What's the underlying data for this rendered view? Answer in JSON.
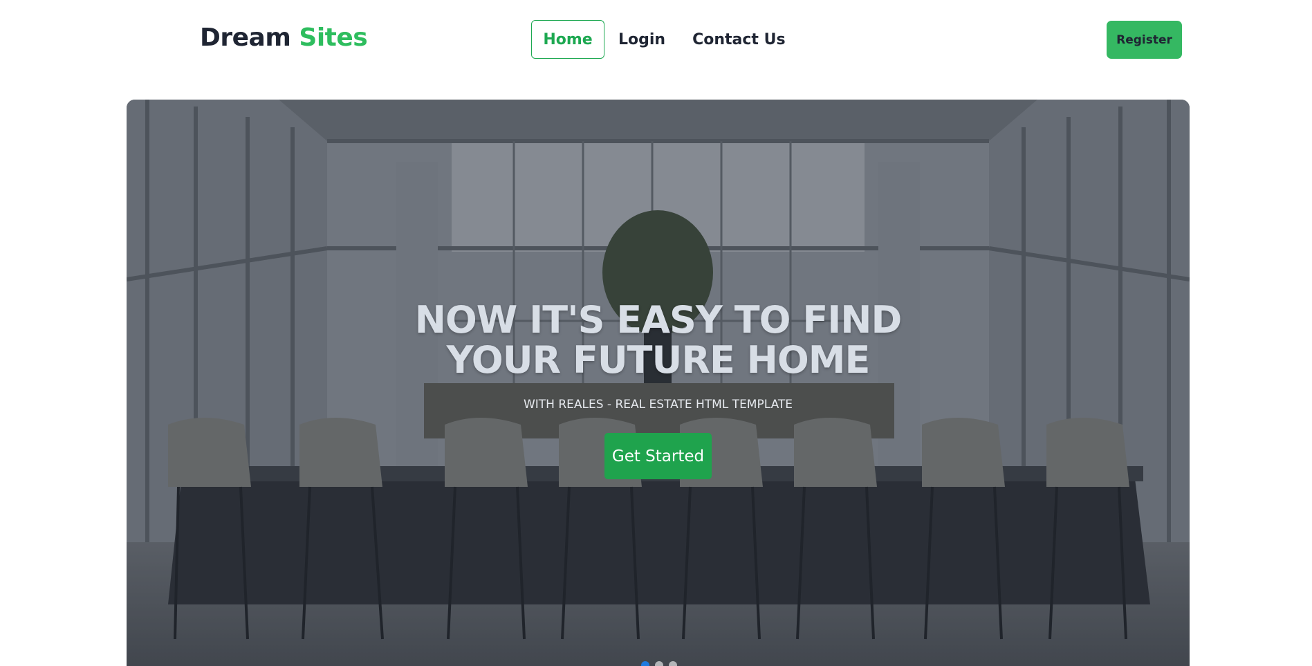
{
  "brand": {
    "name_part1": "Dream",
    "name_part2": "Sites"
  },
  "nav": {
    "items": [
      {
        "label": "Home",
        "active": true
      },
      {
        "label": "Login",
        "active": false
      },
      {
        "label": "Contact Us",
        "active": false
      }
    ],
    "register_label": "Register"
  },
  "hero": {
    "title_line1": "NOW IT'S EASY TO FIND",
    "title_line2": "YOUR FUTURE HOME",
    "subtitle": "WITH REALES - REAL ESTATE HTML TEMPLATE",
    "cta_label": "Get Started",
    "background_image": "luxury-bar-interior-with-stools",
    "carousel": {
      "slide_count": 3,
      "active_index": 0
    }
  },
  "colors": {
    "brand_accent": "#2ebd5e",
    "nav_active": "#1da851",
    "register_bg": "#35b862",
    "cta_bg": "#1fa34d",
    "text_dark": "#1f2533"
  }
}
